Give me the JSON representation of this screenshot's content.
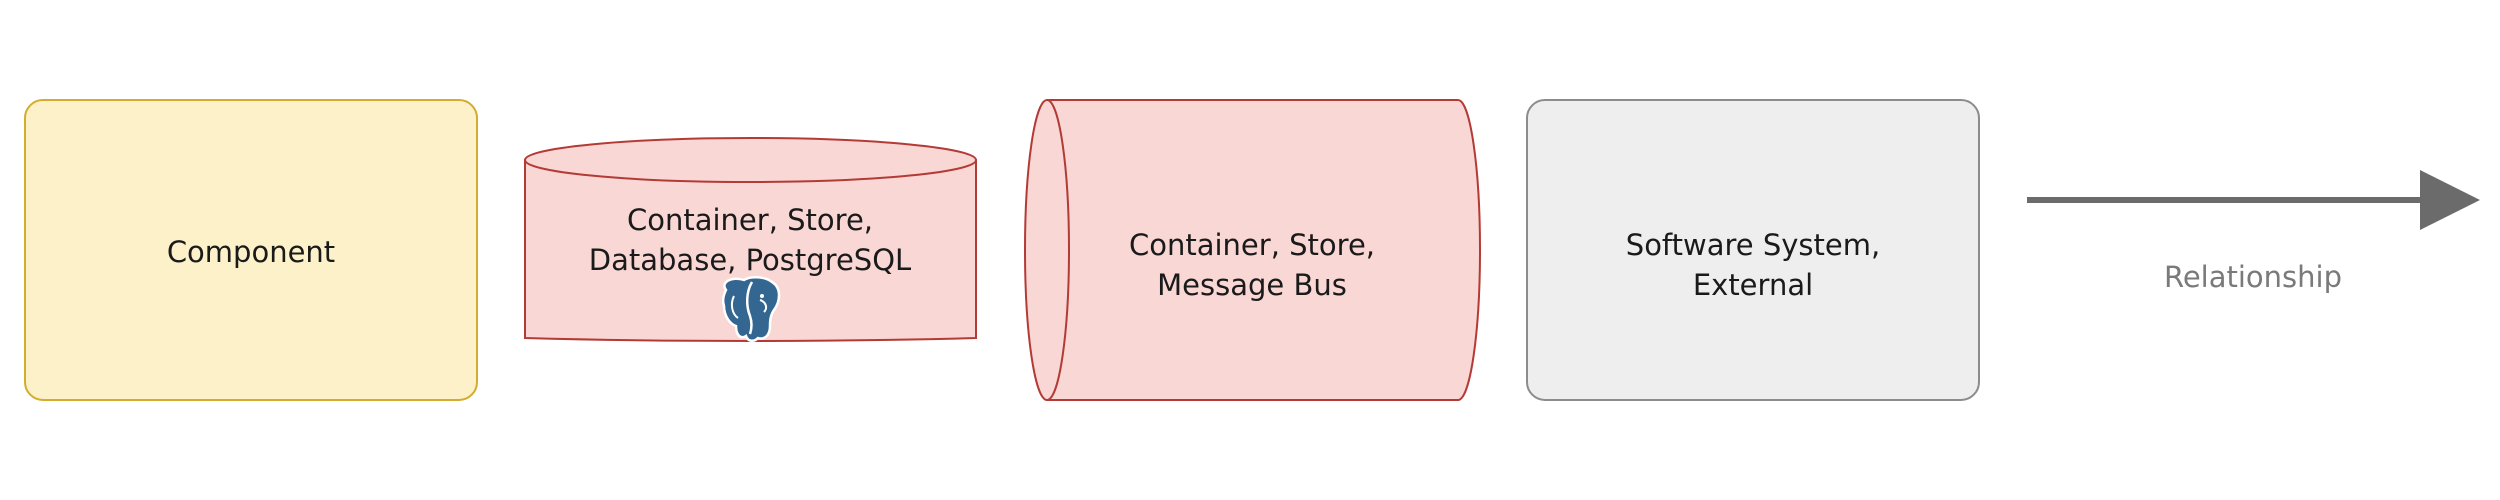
{
  "colors": {
    "component_fill": "#fdf1c9",
    "component_stroke": "#d4ac2f",
    "store_fill": "#f8d7d5",
    "store_stroke": "#b43a35",
    "external_fill": "#eeeeee",
    "external_stroke": "#8c8c8c",
    "relationship_stroke": "#6b6b6b",
    "postgres_blue": "#336791"
  },
  "shapes": {
    "component": {
      "label": "Component"
    },
    "database": {
      "line1": "Container, Store,",
      "line2": "Database, PostgreSQL",
      "icon": "postgresql-elephant-icon"
    },
    "message_bus": {
      "line1": "Container, Store,",
      "line2": "Message Bus"
    },
    "external_system": {
      "line1": "Software System,",
      "line2": "External"
    },
    "relationship": {
      "label": "Relationship",
      "icon": "arrow-right-icon"
    }
  }
}
